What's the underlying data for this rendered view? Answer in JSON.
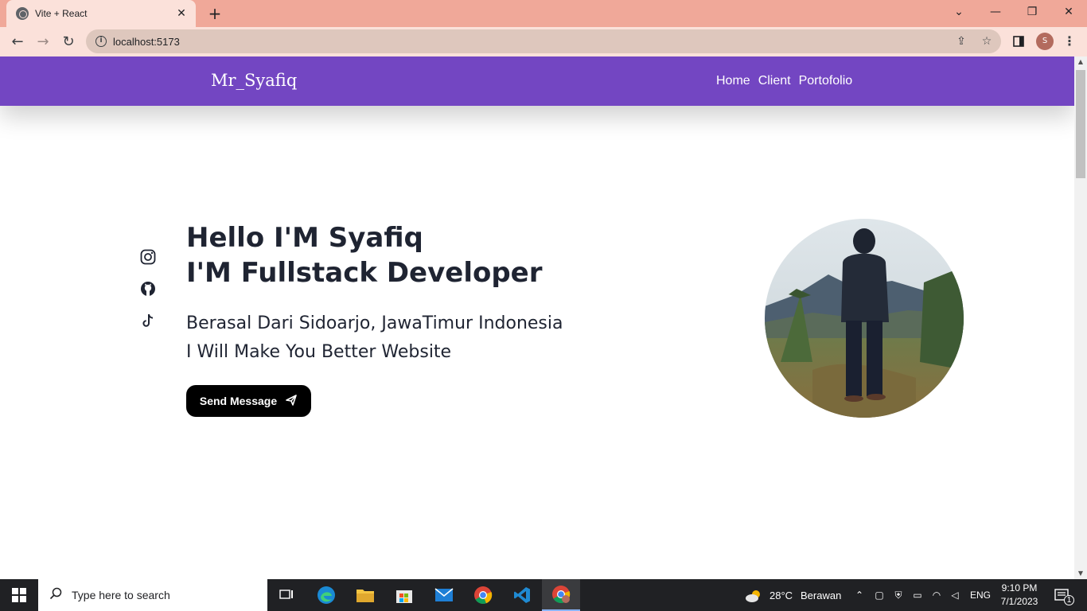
{
  "browser": {
    "tab_title": "Vite + React",
    "url": "localhost:5173",
    "profile_initial": "S"
  },
  "site": {
    "brand": "Mr_Syafiq",
    "nav": [
      "Home",
      "Client",
      "Portofolio"
    ],
    "hero_title_line1": "Hello I'M Syafiq",
    "hero_title_line2": "I'M Fullstack Developer",
    "hero_sub_line1": "Berasal Dari Sidoarjo, JawaTimur Indonesia",
    "hero_sub_line2": "I Will Make You Better Website",
    "send_button": "Send Message",
    "socials": [
      "instagram-icon",
      "github-icon",
      "tiktok-icon"
    ],
    "accent_color": "#7346c2"
  },
  "taskbar": {
    "search_placeholder": "Type here to search",
    "weather_temp": "28°C",
    "weather_text": "Berawan",
    "language": "ENG",
    "time": "9:10 PM",
    "date": "7/1/2023",
    "notification_count": "1"
  }
}
